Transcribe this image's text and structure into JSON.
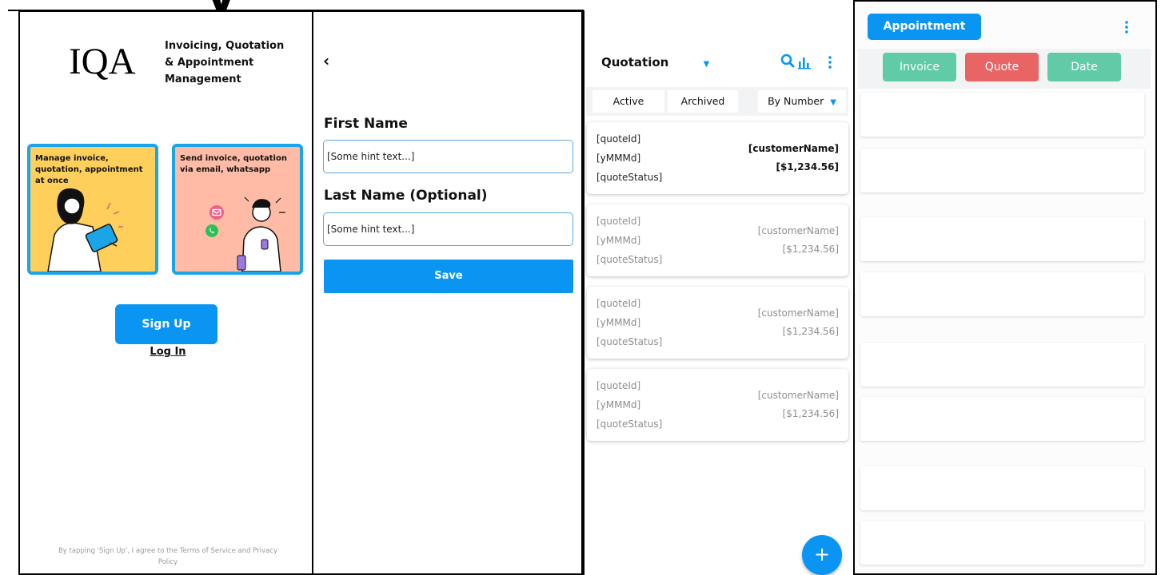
{
  "colors": {
    "primary": "#0b95f3",
    "card_border": "#1aa5e8",
    "card_yellow": "#ffcf5c",
    "card_pink": "#ffbba5",
    "tab_green": "#60cba6",
    "tab_red": "#e96465"
  },
  "signup_screen": {
    "logo": "IQA",
    "tagline": "Invoicing, Quotation & Appointment Management",
    "cards": [
      {
        "text": "Manage invoice, quotation, appointment at once",
        "icons": [
          "woman-tablet-illustration"
        ]
      },
      {
        "text": "Send invoice, quotation via email, whatsapp",
        "icons": [
          "email-icon",
          "whatsapp-icon",
          "man-phone-illustration"
        ]
      }
    ],
    "signup_label": "Sign Up",
    "login_label": "Log In",
    "terms": "By tapping 'Sign Up', I agree to the Terms of Service and Privacy Policy"
  },
  "name_screen": {
    "back_icon": "chevron-left-icon",
    "first_name_label": "First Name",
    "first_name_placeholder": "[Some hint text...]",
    "last_name_label": "Last Name (Optional)",
    "last_name_placeholder": "[Some hint text...]",
    "save_label": "Save"
  },
  "quotation_screen": {
    "title": "Quotation",
    "tabs": [
      "Active",
      "Archived"
    ],
    "sort_label": "By Number",
    "icons": [
      "search-icon",
      "bar-chart-icon",
      "more-vert-icon"
    ],
    "quotes": [
      {
        "id": "[quoteId]",
        "date": "[yMMMd]",
        "status": "[quoteStatus]",
        "customer": "[customerName]",
        "amount": "[$1,234.56]"
      },
      {
        "id": "[quoteId]",
        "date": "[yMMMd]",
        "status": "[quoteStatus]",
        "customer": "[customerName]",
        "amount": "[$1,234.56]"
      },
      {
        "id": "[quoteId]",
        "date": "[yMMMd]",
        "status": "[quoteStatus]",
        "customer": "[customerName]",
        "amount": "[$1,234.56]"
      },
      {
        "id": "[quoteId]",
        "date": "[yMMMd]",
        "status": "[quoteStatus]",
        "customer": "[customerName]",
        "amount": "[$1,234.56]"
      }
    ],
    "fab_label": "+"
  },
  "appointment_screen": {
    "title": "Appointment",
    "tabs": [
      "Invoice",
      "Quote",
      "Date"
    ]
  }
}
